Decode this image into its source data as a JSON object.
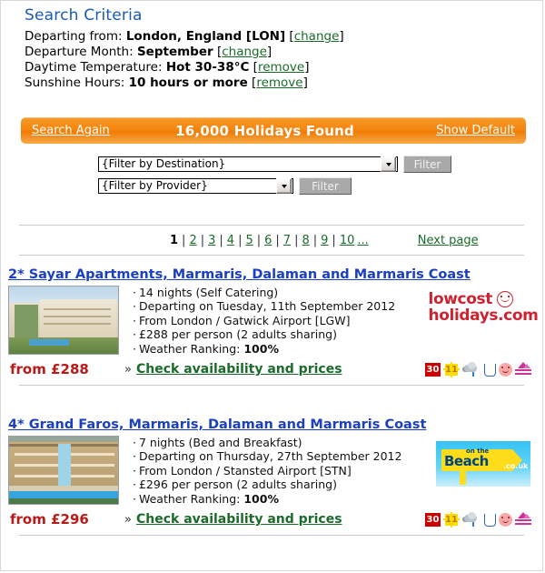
{
  "criteria": {
    "title": "Search Criteria",
    "lines": [
      {
        "label": "Departing from:",
        "value": "London, England [LON]",
        "action": "change"
      },
      {
        "label": "Departure Month:",
        "value": "September",
        "action": "change"
      },
      {
        "label": "Daytime Temperature:",
        "value": "Hot 30-38°C",
        "action": "remove"
      },
      {
        "label": "Sunshine Hours:",
        "value": "10 hours or more",
        "action": "remove"
      }
    ]
  },
  "results_bar": {
    "search_again": "Search Again",
    "count_text": "16,000 Holidays Found",
    "show_default": "Show Default",
    "accent_color": "#f4860f"
  },
  "filters": [
    {
      "selected": "{Filter by Destination}",
      "button": "Filter"
    },
    {
      "selected": "{Filter by Provider}",
      "button": "Filter"
    }
  ],
  "pagination": {
    "current": "1",
    "pages": [
      "2",
      "3",
      "4",
      "5",
      "6",
      "7",
      "8",
      "9",
      "10"
    ],
    "ellipsis": "...",
    "separator": "|",
    "next_label": "Next page"
  },
  "listings": [
    {
      "title": "2* Sayar Apartments, Marmaris, Dalaman and Marmaris Coast",
      "details": [
        "14 nights (Self Catering)",
        "Departing on Tuesday, 11th September 2012",
        "From London / Gatwick Airport [LGW]",
        "£288 per person (2 adults sharing)"
      ],
      "weather_label": "Weather Ranking:",
      "weather_value": "100%",
      "provider": "lowcostholidays.com",
      "provider_text": {
        "line1": "lowcost",
        "line2": "holidays.com"
      },
      "price": "from £288",
      "chevron": "»",
      "check_link": "Check availability and prices",
      "icons": {
        "temp": "30",
        "sunshine": "11"
      }
    },
    {
      "title": "4* Grand Faros, Marmaris, Dalaman and Marmaris Coast",
      "details": [
        "7 nights (Bed and Breakfast)",
        "Departing on Thursday, 27th September 2012",
        "From London / Stansted Airport [STN]",
        "£296 per person (2 adults sharing)"
      ],
      "weather_label": "Weather Ranking:",
      "weather_value": "100%",
      "provider": "On the Beach",
      "provider_text": {
        "small": "on the",
        "main": "Beach",
        "tld": ".co.uk"
      },
      "price": "from £296",
      "chevron": "»",
      "check_link": "Check availability and prices",
      "icons": {
        "temp": "30",
        "sunshine": "11"
      }
    }
  ]
}
